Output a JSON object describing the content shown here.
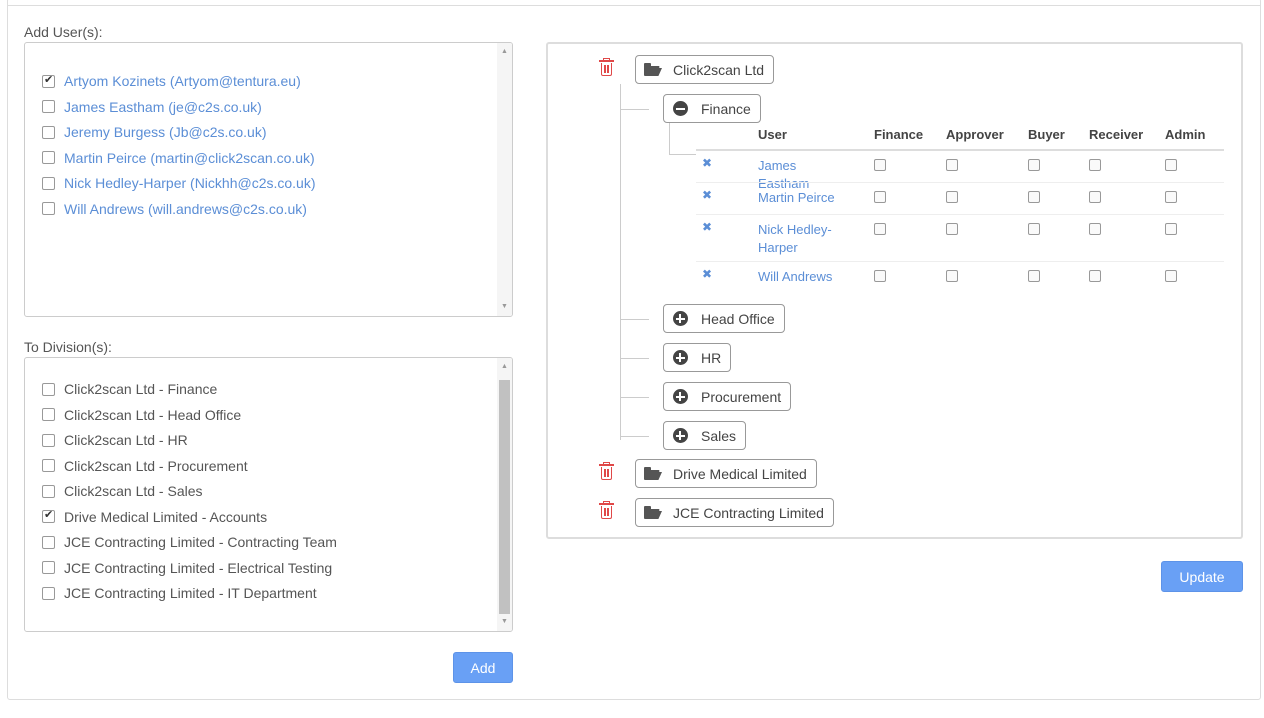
{
  "add_users": {
    "label": "Add User(s):",
    "items": [
      {
        "label": "Artyom Kozinets (Artyom@tentura.eu)",
        "checked": true
      },
      {
        "label": "James Eastham (je@c2s.co.uk)",
        "checked": false
      },
      {
        "label": "Jeremy Burgess (Jb@c2s.co.uk)",
        "checked": false
      },
      {
        "label": "Martin Peirce (martin@click2scan.co.uk)",
        "checked": false
      },
      {
        "label": "Nick Hedley-Harper (Nickhh@c2s.co.uk)",
        "checked": false
      },
      {
        "label": "Will Andrews (will.andrews@c2s.co.uk)",
        "checked": false
      }
    ]
  },
  "to_divisions": {
    "label": "To Division(s):",
    "items": [
      {
        "label": "Click2scan Ltd - Finance",
        "checked": false
      },
      {
        "label": "Click2scan Ltd - Head Office",
        "checked": false
      },
      {
        "label": "Click2scan Ltd - HR",
        "checked": false
      },
      {
        "label": "Click2scan Ltd - Procurement",
        "checked": false
      },
      {
        "label": "Click2scan Ltd - Sales",
        "checked": false
      },
      {
        "label": "Drive Medical Limited - Accounts",
        "checked": true
      },
      {
        "label": "JCE Contracting Limited - Contracting Team",
        "checked": false
      },
      {
        "label": "JCE Contracting Limited - Electrical Testing",
        "checked": false
      },
      {
        "label": "JCE Contracting Limited - IT Department",
        "checked": false
      }
    ]
  },
  "buttons": {
    "add": "Add",
    "update": "Update"
  },
  "tree": {
    "companies": [
      {
        "name": "Click2scan Ltd",
        "expanded": true
      },
      {
        "name": "Drive Medical Limited",
        "expanded": false
      },
      {
        "name": "JCE Contracting Limited",
        "expanded": false
      }
    ],
    "divisions": [
      {
        "name": "Finance",
        "expanded": true
      },
      {
        "name": "Head Office",
        "expanded": false
      },
      {
        "name": "HR",
        "expanded": false
      },
      {
        "name": "Procurement",
        "expanded": false
      },
      {
        "name": "Sales",
        "expanded": false
      }
    ],
    "grid": {
      "headers": [
        "User",
        "Finance",
        "Approver",
        "Buyer",
        "Receiver",
        "Admin"
      ],
      "rows": [
        {
          "name": "James Eastham",
          "roles": [
            false,
            false,
            false,
            false,
            false
          ]
        },
        {
          "name": "Martin Peirce",
          "roles": [
            false,
            false,
            false,
            false,
            false
          ]
        },
        {
          "name": "Nick Hedley-Harper",
          "roles": [
            false,
            false,
            false,
            false,
            false
          ]
        },
        {
          "name": "Will Andrews",
          "roles": [
            false,
            false,
            false,
            false,
            false
          ]
        }
      ]
    }
  },
  "icons": {
    "delete": "trash-icon",
    "folder": "folder-open-icon",
    "collapse": "minus-circle-icon",
    "expand": "plus-circle-icon",
    "remove_user": "times-icon"
  },
  "colors": {
    "link": "#5b8ed6",
    "primary": "#69a0f5",
    "danger": "#e04848"
  }
}
